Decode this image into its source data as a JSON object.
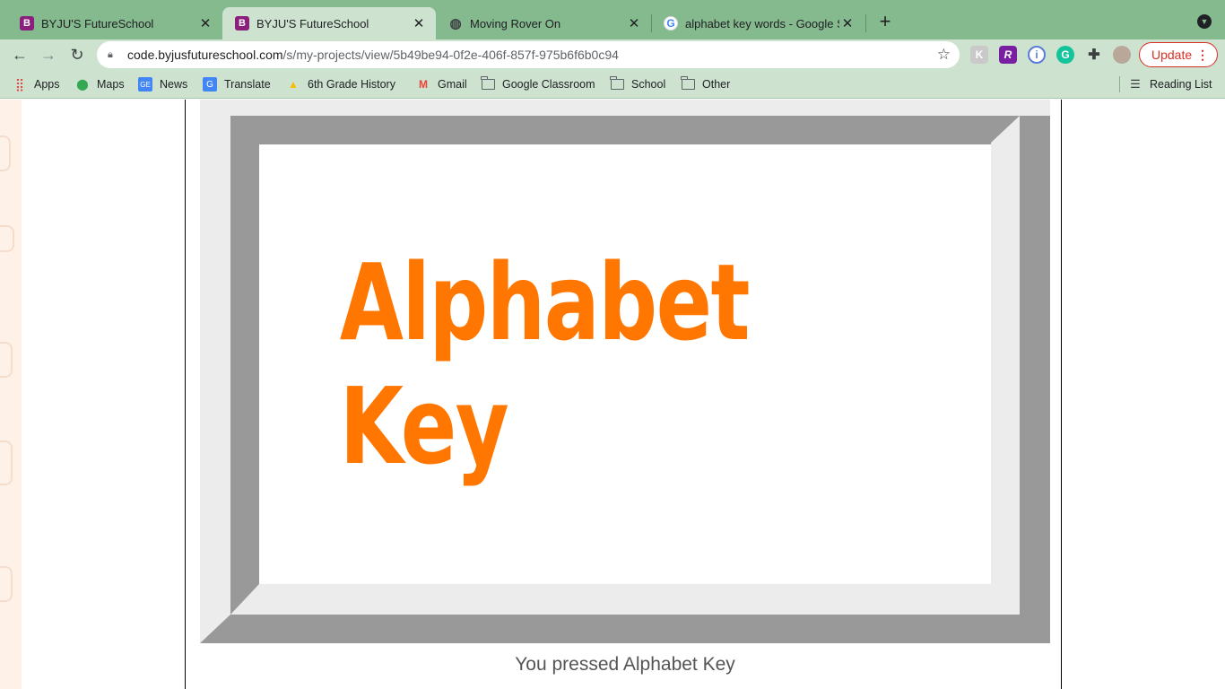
{
  "tabs": [
    {
      "title": "BYJU'S FutureSchool",
      "favicon": "byjus-icon",
      "active": false
    },
    {
      "title": "BYJU'S FutureSchool",
      "favicon": "byjus-icon",
      "active": true
    },
    {
      "title": "Moving Rover On",
      "favicon": "globe-icon",
      "active": false
    },
    {
      "title": "alphabet key words - Google S",
      "favicon": "google-icon",
      "active": false
    }
  ],
  "toolbar": {
    "url_host": "code.byjusfutureschool.com",
    "url_path": "/s/my-projects/view/5b49be94-0f2e-406f-857f-975b6f6b0c94",
    "update_label": "Update"
  },
  "bookmarks": [
    {
      "label": "Apps",
      "icon": "apps-grid-icon"
    },
    {
      "label": "Maps",
      "icon": "maps-pin-icon"
    },
    {
      "label": "News",
      "icon": "news-icon"
    },
    {
      "label": "Translate",
      "icon": "translate-icon"
    },
    {
      "label": "6th Grade History",
      "icon": "drive-icon"
    },
    {
      "label": "Gmail",
      "icon": "gmail-icon"
    },
    {
      "label": "Google Classroom",
      "icon": "folder-icon"
    },
    {
      "label": "School",
      "icon": "folder-icon"
    },
    {
      "label": "Other",
      "icon": "folder-icon"
    }
  ],
  "reading_list_label": "Reading List",
  "project": {
    "button_text": "Alphabet Key",
    "caption": "You pressed Alphabet Key"
  },
  "colors": {
    "tabstrip": "#85b98e",
    "toolbar": "#cde3d0",
    "label_orange": "#ff7700",
    "bevel_dark": "#999999",
    "bevel_light": "#ececec"
  }
}
